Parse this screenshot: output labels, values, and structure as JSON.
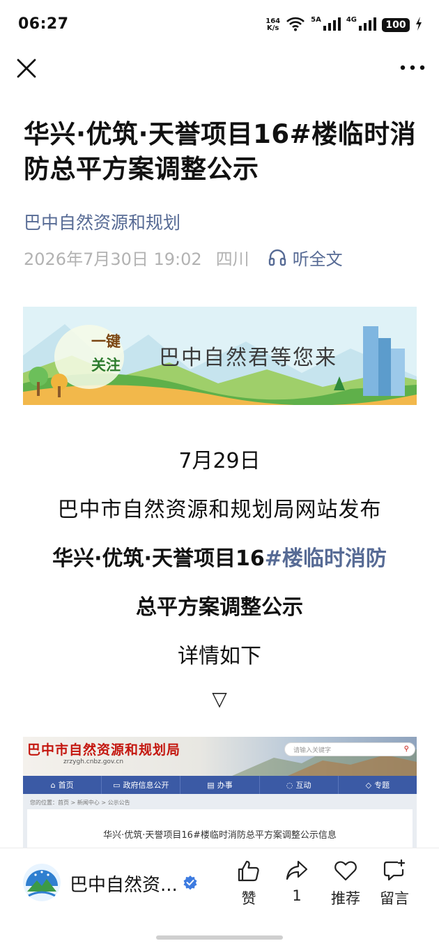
{
  "status_bar": {
    "time": "06:27",
    "net_speed_value": "164",
    "net_speed_unit": "K/s",
    "signal1_label": "5A",
    "signal2_label": "4G",
    "battery": "100",
    "icons": [
      "wifi-icon",
      "signal-icon",
      "charging-icon"
    ]
  },
  "navbar": {
    "icons": [
      "close-icon",
      "more-icon"
    ]
  },
  "article": {
    "title": "华兴·优筑·天誉项目16#楼临时消防总平方案调整公示",
    "account": "巴中自然资源和规划",
    "date": "2026年7月30日 19:02",
    "region": "四川",
    "listen_label": "听全文"
  },
  "banner": {
    "tag_line1": "一键",
    "tag_line2": "关注",
    "slogan": "巴中自然君等您来"
  },
  "body": {
    "date_line": "7月29日",
    "publish_line": "巴中市自然资源和规划局网站发布",
    "bold_part1": "华兴·优筑·天誉项目16",
    "bold_link": "#楼临时消防",
    "bold_line2": "总平方案调整公示",
    "detail_line": "详情如下",
    "arrow": "▽"
  },
  "site_screenshot": {
    "site_name": "巴中市自然资源和规划局",
    "site_url": "zrzygh.cnbz.gov.cn",
    "search_placeholder": "请输入关键字",
    "nav_items": [
      "首页",
      "政府信息公开",
      "办事",
      "互动",
      "专题"
    ],
    "breadcrumb": "您的位置：首页 > 新闻中心 > 公示公告",
    "article_title": "华兴·优筑·天誉项目16#楼临时消防总平方案调整公示信息"
  },
  "bottom_bar": {
    "account": "巴中自然资...",
    "like_label": "赞",
    "share_count": "1",
    "recommend_label": "推荐",
    "comment_label": "留言"
  },
  "colors": {
    "link": "#576b95",
    "meta": "#b2b2b2",
    "site_nav": "#3b5aa5",
    "site_name": "#c4170f"
  }
}
